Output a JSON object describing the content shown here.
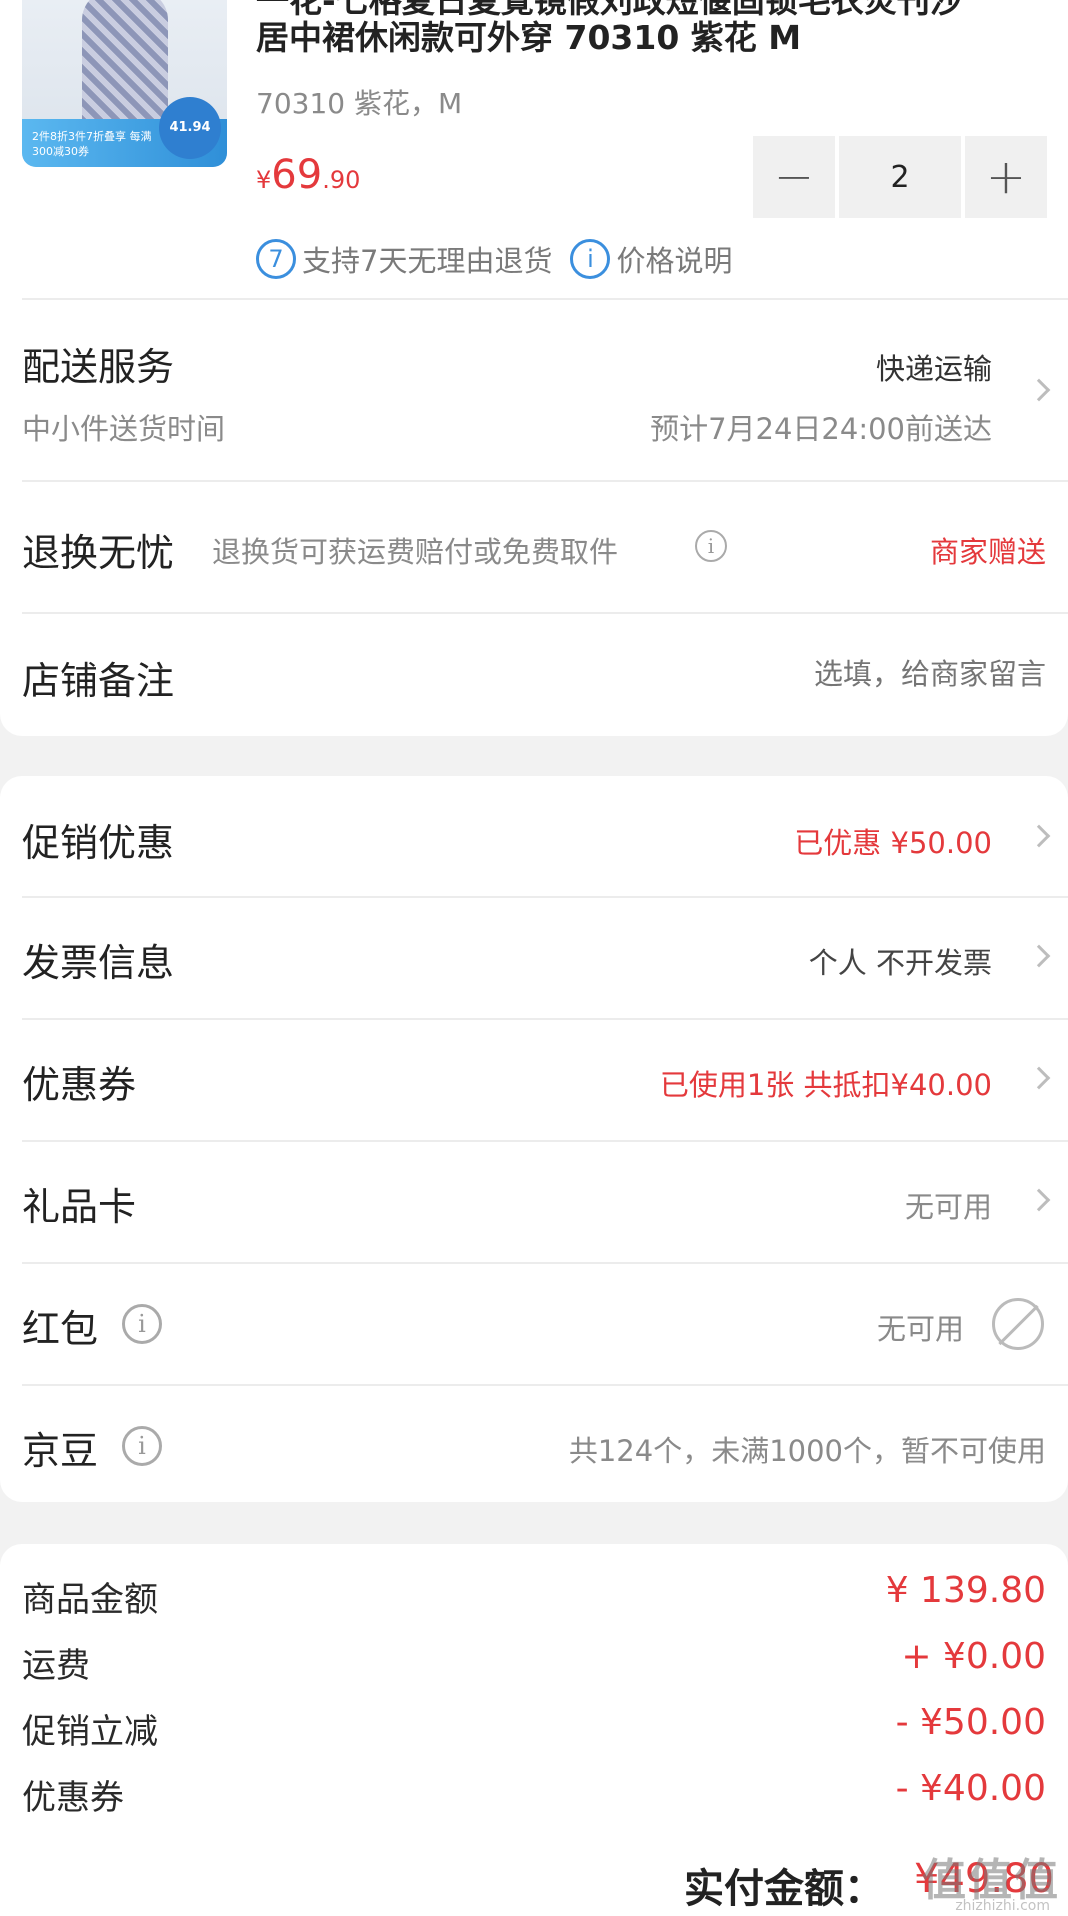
{
  "product": {
    "title_line1_cut": "一花-七格夏日夏覺镜假刘政短偃固锁毛衣炎刊沙",
    "title_line2": "居中裙休闲款可外穿 70310 紫花 M",
    "spec": "70310 紫花，M",
    "price_currency": "¥",
    "price_int": "69",
    "price_dec": ".90",
    "quantity": "2",
    "minus": "−",
    "plus": "+",
    "thumb_price": "41.94",
    "thumb_banner": "2件8折3件7折叠享 每满300减30券",
    "badge_return_icon": "7",
    "badge_return": "支持7天无理由退货",
    "badge_price_icon": "i",
    "badge_price": "价格说明"
  },
  "delivery": {
    "title": "配送服务",
    "method": "快递运输",
    "sub": "中小件送货时间",
    "eta": "预计7月24日24:00前送达"
  },
  "return": {
    "title": "退换无忧",
    "desc": "退换货可获运费赔付或免费取件",
    "value": "商家赠送"
  },
  "remark": {
    "title": "店铺备注",
    "placeholder": "选填，给商家留言"
  },
  "rows": {
    "promo": {
      "title": "促销优惠",
      "value": "已优惠 ¥50.00"
    },
    "invoice": {
      "title": "发票信息",
      "value": "个人 不开发票"
    },
    "coupon": {
      "title": "优惠券",
      "value": "已使用1张 共抵扣¥40.00"
    },
    "giftcard": {
      "title": "礼品卡",
      "value": "无可用"
    },
    "redpacket": {
      "title": "红包",
      "value": "无可用"
    },
    "jingdou": {
      "title": "京豆",
      "value": "共124个，未满1000个，暂不可使用"
    }
  },
  "summary": {
    "goods_label": "商品金额",
    "goods_value": "¥ 139.80",
    "shipping_label": "运费",
    "shipping_value": "+ ¥0.00",
    "promo_label": "促销立减",
    "promo_value": "- ¥50.00",
    "coupon_label": "优惠券",
    "coupon_value": "- ¥40.00",
    "total_label": "实付金额：",
    "total_value": "¥49.80"
  },
  "watermark": {
    "text": "值值值",
    "sub": "zhizhizhi.com"
  },
  "colors": {
    "accent_red": "#e4393c",
    "accent_blue": "#3b8fde",
    "background": "#f2f2f2"
  }
}
